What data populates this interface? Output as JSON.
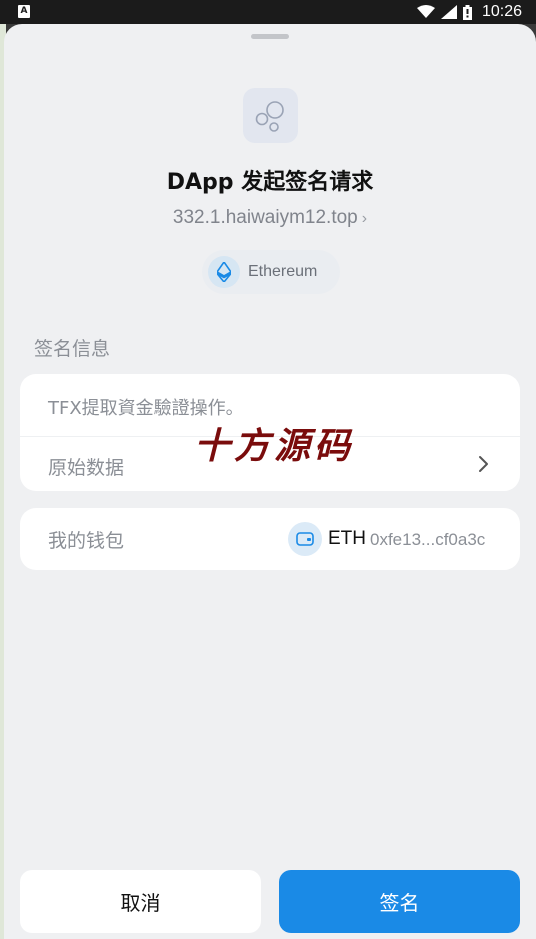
{
  "status_bar": {
    "time": "10:26",
    "icons": [
      "notification-a-icon",
      "wifi-icon",
      "signal-icon",
      "battery-icon"
    ]
  },
  "dapp": {
    "title": "DApp 发起签名请求",
    "origin": "332.1.haiwaiym12.top",
    "network": "Ethereum",
    "icon": "bubbles-icon"
  },
  "sign_info": {
    "section_label": "签名信息",
    "message": "TFX提取資金驗證操作。",
    "raw_data_label": "原始数据"
  },
  "wallet": {
    "label": "我的钱包",
    "chain": "ETH",
    "address": "0xfe13...cf0a3c"
  },
  "watermark": "十方源码",
  "buttons": {
    "cancel": "取消",
    "sign": "签名"
  },
  "colors": {
    "accent": "#1a8ae6",
    "sheet_bg": "#eff0f2",
    "watermark": "#7a0c0c"
  }
}
